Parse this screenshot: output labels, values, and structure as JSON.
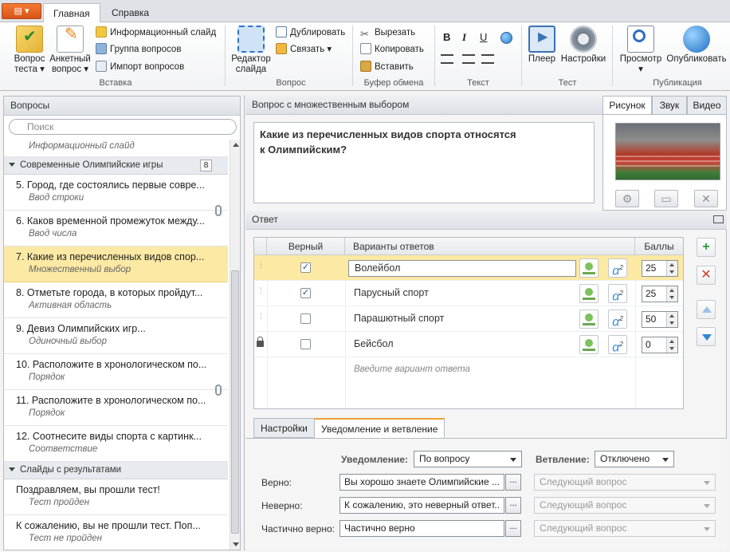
{
  "ribbon": {
    "app_button": "▤ ▾",
    "tabs": [
      "Главная",
      "Справка"
    ],
    "groups": {
      "insert": {
        "label": "Вставка",
        "question": "Вопрос\nтеста ▾",
        "survey": "Анкетный\nвопрос ▾",
        "info_slide": "Информационный слайд",
        "question_group": "Группа вопросов",
        "import": "Импорт вопросов"
      },
      "question": {
        "label": "Вопрос",
        "slide_editor": "Редактор\nслайда",
        "duplicate": "Дублировать",
        "link": "Связать ▾"
      },
      "clipboard": {
        "label": "Буфер обмена",
        "cut": "Вырезать",
        "copy": "Копировать",
        "paste": "Вставить"
      },
      "text": {
        "label": "Текст",
        "bold": "B",
        "italic": "I",
        "underline": "U"
      },
      "test": {
        "label": "Тест",
        "player": "Плеер",
        "settings": "Настройки"
      },
      "publish": {
        "label": "Публикация",
        "preview": "Просмотр\n▾",
        "publish": "Опубликовать"
      }
    }
  },
  "left": {
    "header": "Вопросы",
    "search_placeholder": "Поиск",
    "top_item_subtitle": "Информационный слайд",
    "group1": {
      "title": "Современные Олимпийские игры",
      "count": "8"
    },
    "questions": [
      {
        "title": "5. Город, где состоялись первые совре...",
        "type": "Ввод строки"
      },
      {
        "title": "6. Каков временной промежуток между...",
        "type": "Ввод числа"
      },
      {
        "title": "7. Какие из перечисленных видов спор...",
        "type": "Множественный выбор"
      },
      {
        "title": "8. Отметьте города, в которых пройдут...",
        "type": "Активная область"
      },
      {
        "title": "9. Девиз Олимпийских игр...",
        "type": "Одиночный выбор"
      },
      {
        "title": "10. Расположите в хронологическом по...",
        "type": "Порядок"
      },
      {
        "title": "11. Расположите в хронологическом по...",
        "type": "Порядок"
      },
      {
        "title": "12.  Соотнесите виды спорта с картинк...",
        "type": "Соответствие"
      }
    ],
    "group2": {
      "title": "Слайды с результатами"
    },
    "results": [
      {
        "title": "Поздравляем, вы прошли тест!",
        "type": "Тест пройден"
      },
      {
        "title": "К сожалению, вы не прошли тест. Поп...",
        "type": "Тест не пройден"
      }
    ]
  },
  "question": {
    "header": "Вопрос с множественным выбором",
    "text": "Какие из перечисленных видов спорта относятся\nк Олимпийским?"
  },
  "media": {
    "tabs": [
      "Рисунок",
      "Звук",
      "Видео"
    ]
  },
  "answers": {
    "header": "Ответ",
    "columns": {
      "correct": "Верный",
      "options": "Варианты ответов",
      "points": "Баллы"
    },
    "rows": [
      {
        "text": "Волейбол",
        "correct": true,
        "points": "25"
      },
      {
        "text": "Парусный спорт",
        "correct": true,
        "points": "25"
      },
      {
        "text": "Парашютный спорт",
        "correct": false,
        "points": "50"
      },
      {
        "text": "Бейсбол",
        "correct": false,
        "points": "0"
      }
    ],
    "new_placeholder": "Введите вариант ответа",
    "formula_label": "α",
    "formula_sup": "2"
  },
  "bottom": {
    "tabs": [
      "Настройки",
      "Уведомление и ветвление"
    ],
    "notification_label": "Уведомление:",
    "notification_value": "По вопросу",
    "branching_label": "Ветвление:",
    "branching_value": "Отключено",
    "rows": [
      {
        "label": "Верно:",
        "text": "Вы хорошо знаете Олимпийские ...",
        "next": "Следующий вопрос"
      },
      {
        "label": "Неверно:",
        "text": "К сожалению, это неверный ответ..",
        "next": "Следующий вопрос"
      },
      {
        "label": "Частично верно:",
        "text": "Частично верно",
        "next": "Следующий вопрос"
      }
    ],
    "dots": "..."
  },
  "colors": {
    "selection": "#fbe9a4",
    "accent_tab": "#f0a030",
    "app_button": "#e8661f"
  }
}
